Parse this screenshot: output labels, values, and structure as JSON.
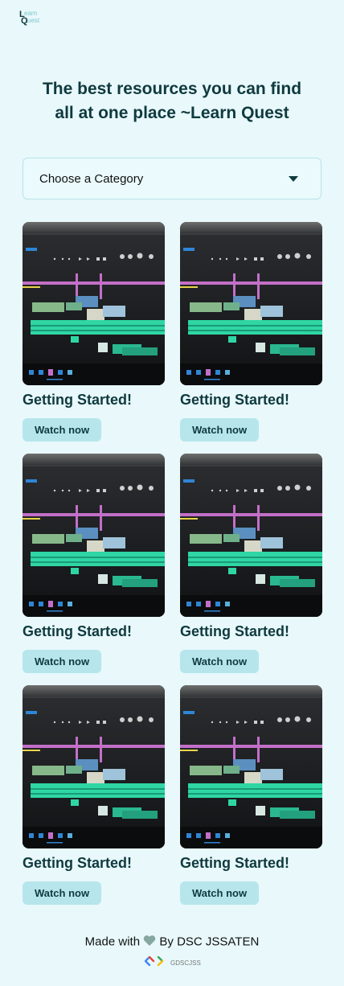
{
  "logo": {
    "line1_a": "L",
    "line1_b": "earn",
    "line2_a": "Q",
    "line2_b": "uest"
  },
  "headline": {
    "line1": "The best resources you can find",
    "line2": "all at one place ~Learn Quest"
  },
  "category_select": {
    "value": "Choose a Category",
    "icon": "caret-down-icon"
  },
  "cards": [
    {
      "title": "Getting Started!",
      "button": "Watch now"
    },
    {
      "title": "Getting Started!",
      "button": "Watch now"
    },
    {
      "title": "Getting Started!",
      "button": "Watch now"
    },
    {
      "title": "Getting Started!",
      "button": "Watch now"
    },
    {
      "title": "Getting Started!",
      "button": "Watch now"
    },
    {
      "title": "Getting Started!",
      "button": "Watch now"
    }
  ],
  "footer": {
    "made_with": "Made with",
    "by": "By DSC JSSATEN",
    "badge": "GDSCJSS"
  },
  "colors": {
    "background": "#e8f8fb",
    "primary_text": "#0f3a3f",
    "button_bg": "#b6e6ec",
    "heart": "#86a6a0"
  }
}
